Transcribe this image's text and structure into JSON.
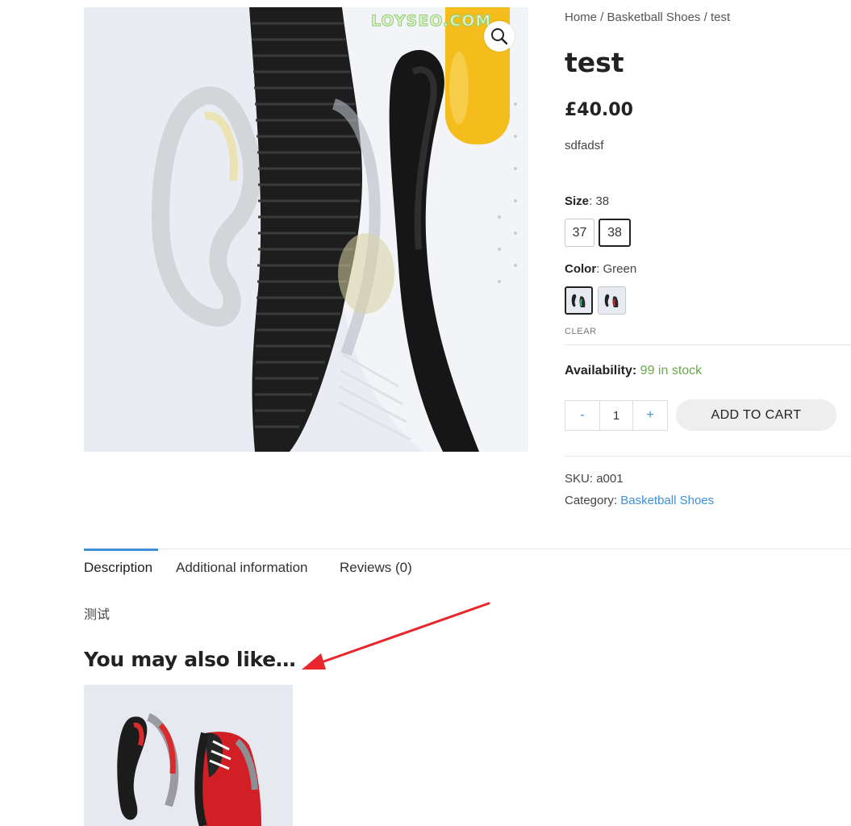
{
  "gallery": {
    "watermark": "LOYSEO.COM",
    "zoom_icon": "magnifier-icon"
  },
  "breadcrumb": {
    "home": "Home",
    "sep1": " / ",
    "category": "Basketball Shoes",
    "sep2": " / ",
    "current": "test"
  },
  "product": {
    "title": "test",
    "price": "£40.00",
    "short_description": "sdfadsf",
    "size_label": "Size",
    "size_value": "38",
    "sizes": [
      "37",
      "38"
    ],
    "color_label": "Color",
    "color_value": "Green",
    "clear": "CLEAR",
    "availability_label": "Availability:",
    "availability_value": "99 in stock",
    "qty_minus": "-",
    "qty_value": "1",
    "qty_plus": "+",
    "add_to_cart": "ADD TO CART",
    "sku_label": "SKU:",
    "sku_value": "a001",
    "category_label": "Category:",
    "category_value": "Basketball Shoes"
  },
  "tabs": {
    "description": "Description",
    "additional": "Additional information",
    "reviews": "Reviews (0)"
  },
  "description_content": "测试",
  "related": {
    "title": "You may also like…"
  },
  "colors": {
    "accent": "#3d8fd6",
    "stock": "#6aa84f",
    "annotation_arrow": "#e8262b"
  }
}
